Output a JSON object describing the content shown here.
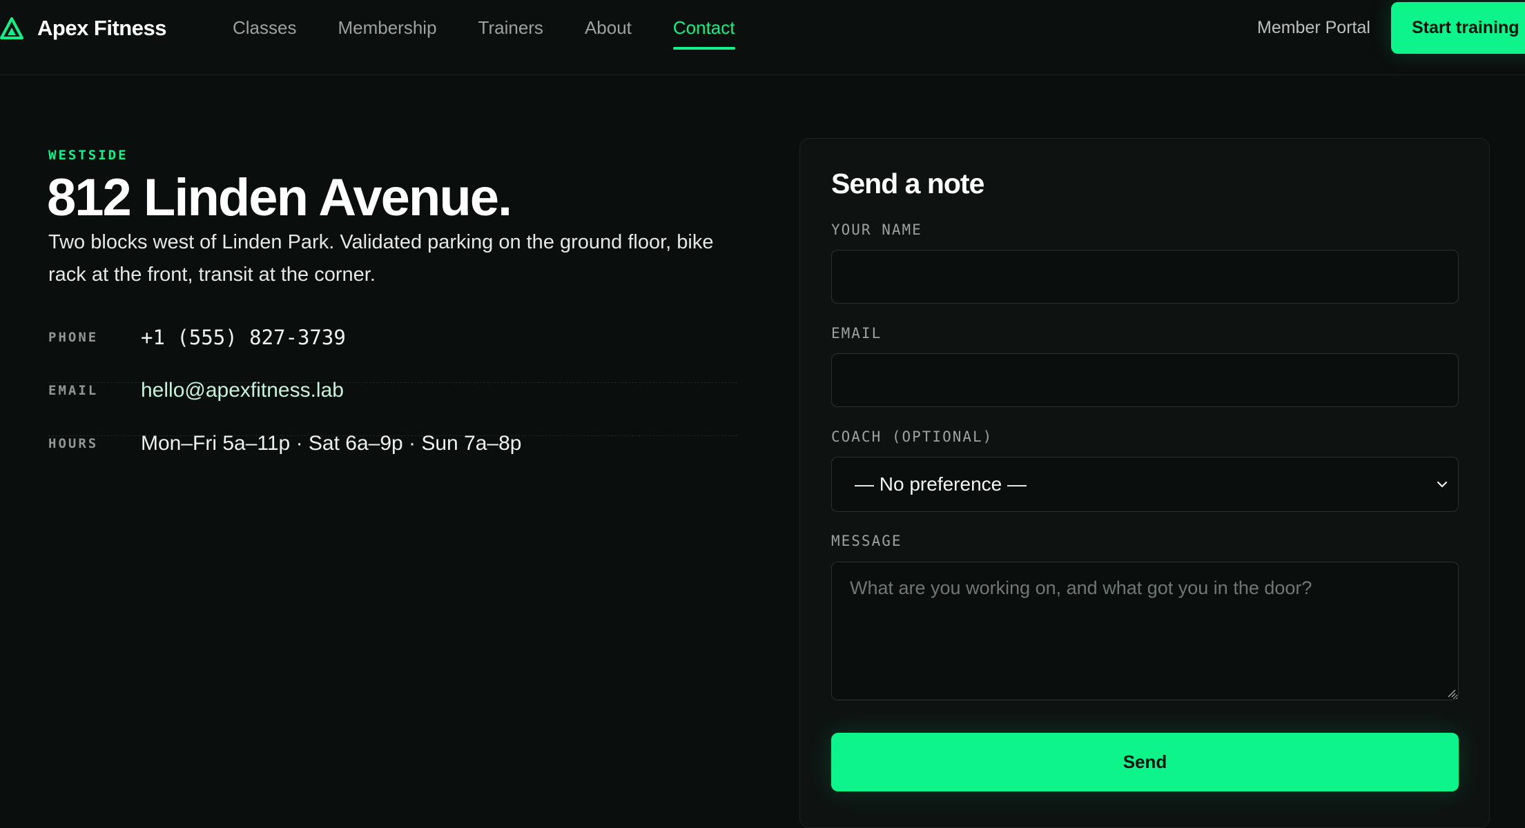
{
  "brand": {
    "name": "Apex Fitness",
    "logo_icon": "triangle-logo-icon",
    "accent": "#12f08a"
  },
  "nav": {
    "links": [
      {
        "label": "Classes"
      },
      {
        "label": "Membership"
      },
      {
        "label": "Trainers"
      },
      {
        "label": "About"
      },
      {
        "label": "Contact",
        "active": true
      }
    ],
    "member_portal": "Member Portal",
    "cta": "Start training"
  },
  "location": {
    "eyebrow": "WESTSIDE",
    "headline": "812 Linden Avenue.",
    "intro": "Two blocks west of Linden Park. Validated parking on the ground floor, bike rack at the front, transit at the corner.",
    "details": [
      {
        "label": "PHONE",
        "value": "+1 (555) 827-3739"
      },
      {
        "label": "EMAIL",
        "value": "hello@apexfitness.lab"
      },
      {
        "label": "HOURS",
        "value": "Mon–Fri 5a–11p · Sat 6a–9p · Sun 7a–8p"
      }
    ]
  },
  "form": {
    "title": "Send a note",
    "name_label": "YOUR NAME",
    "name_value": "",
    "email_label": "EMAIL",
    "email_value": "",
    "coach_label": "COACH (OPTIONAL)",
    "coach_selected": "— No preference —",
    "message_label": "MESSAGE",
    "message_placeholder": "What are you working on, and what got you in the door?",
    "send_label": "Send"
  },
  "colors": {
    "background": "#0a0e0d",
    "accent": "#0df58a",
    "card": "#0e1312"
  }
}
